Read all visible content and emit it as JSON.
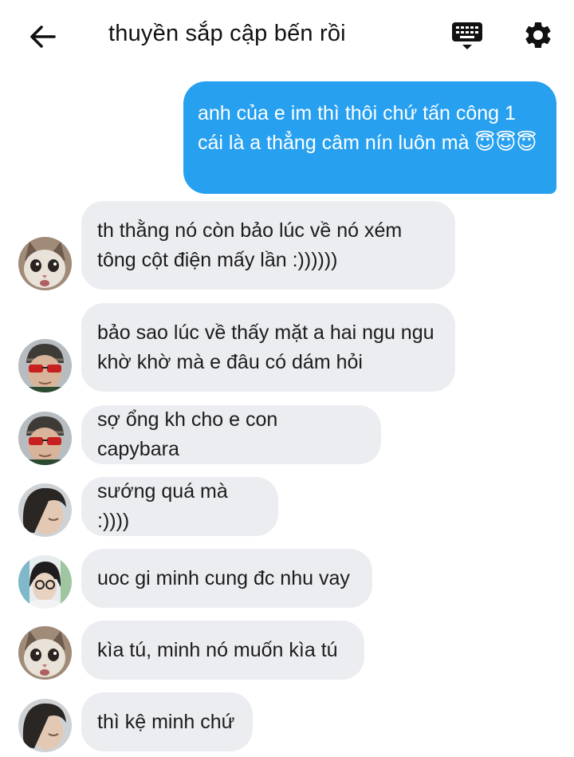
{
  "header": {
    "title": "thuyền sắp cập bến rồi",
    "back_icon": "arrow-left-icon",
    "keyboard_icon": "keyboard-icon",
    "settings_icon": "gear-icon"
  },
  "colors": {
    "outgoing_bubble": "#27a0f0",
    "incoming_bubble": "#ecedf0"
  },
  "messages": [
    {
      "from": "me",
      "text": "anh của e im thì thôi chứ tấn công 1 cái là a thẳng câm nín luôn mà 😇😇😇"
    },
    {
      "from": "cat",
      "text": "th thằng nó còn bảo lúc về nó xém tông cột điện mấy lần :))))))"
    },
    {
      "from": "sunglasses",
      "text": "bảo sao lúc về thấy mặt a hai ngu ngu khờ khờ mà e đâu có dám hỏi"
    },
    {
      "from": "sunglasses",
      "text": "sợ ổng kh cho e con capybara"
    },
    {
      "from": "long-hair",
      "text": "sướng quá mà :))))"
    },
    {
      "from": "glasses",
      "text": "uoc gi minh cung đc nhu vay"
    },
    {
      "from": "cat",
      "text": "kìa tú, minh nó muốn kìa tú"
    },
    {
      "from": "long-hair",
      "text": "thì kệ minh chứ"
    }
  ]
}
